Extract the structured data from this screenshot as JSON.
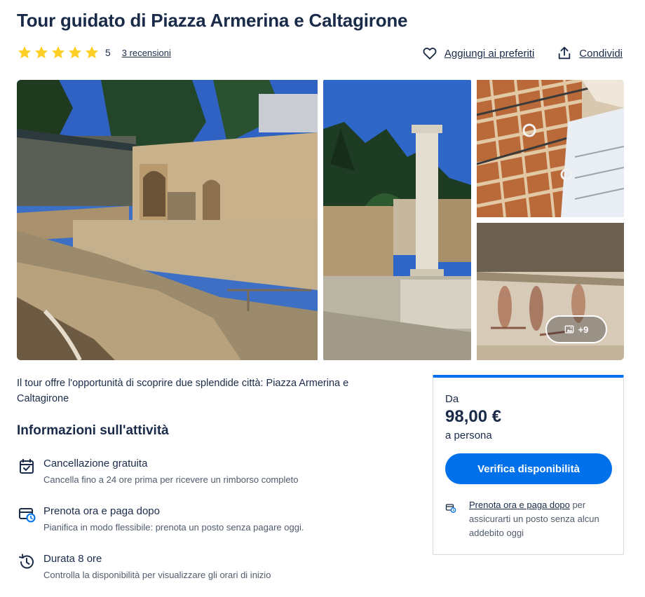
{
  "title": "Tour guidato di Piazza Armerina e Caltagirone",
  "rating": {
    "stars": 5,
    "value": "5",
    "reviews_label": "3 recensioni"
  },
  "actions": {
    "favorite_label": "Aggiungi ai preferiti",
    "share_label": "Condividi"
  },
  "gallery": {
    "more_label": "+9"
  },
  "intro": "Il tour offre l'opportunità di scoprire due splendide città: Piazza Armerina e Caltagirone",
  "activity": {
    "section_title": "Informazioni sull'attività",
    "items": [
      {
        "icon": "calendar-check-icon",
        "title": "Cancellazione gratuita",
        "subtitle": "Cancella fino a 24 ore prima per ricevere un rimborso completo"
      },
      {
        "icon": "card-clock-icon",
        "title": "Prenota ora e paga dopo",
        "subtitle": "Pianifica in modo flessibile: prenota un posto senza pagare oggi."
      },
      {
        "icon": "history-icon",
        "title": "Durata 8 ore",
        "subtitle": "Controlla la disponibilità per visualizzare gli orari di inizio"
      }
    ]
  },
  "booking": {
    "from_label": "Da",
    "price": "98,00 €",
    "unit": "a persona",
    "button_label": "Verifica disponibilità",
    "rpl_link": "Prenota ora e paga dopo",
    "rpl_text": " per assicurarti un posto senza alcun addebito oggi"
  },
  "colors": {
    "primary": "#0071eb",
    "text": "#1a2b49",
    "star": "#fcd025"
  }
}
